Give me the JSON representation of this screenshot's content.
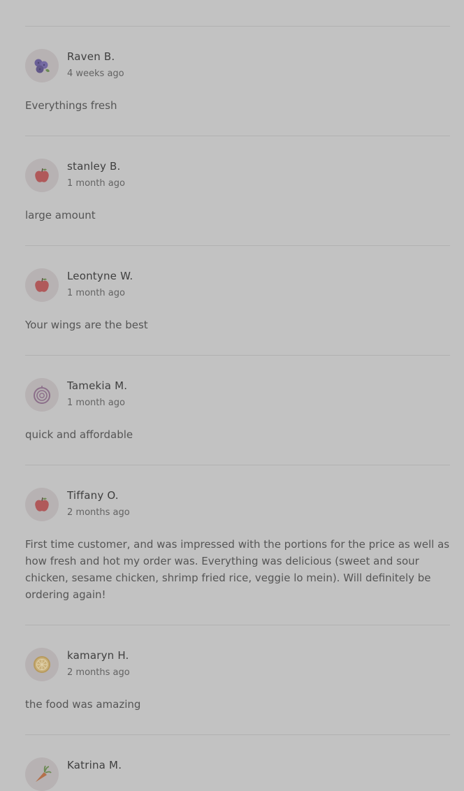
{
  "reviews": [
    {
      "name": "Raven B.",
      "time": "4 weeks ago",
      "text": "Everythings fresh",
      "avatar_icon": "blueberry-icon"
    },
    {
      "name": "stanley B.",
      "time": "1 month ago",
      "text": "large amount",
      "avatar_icon": "apple-icon"
    },
    {
      "name": "Leontyne W.",
      "time": "1 month ago",
      "text": "Your wings are the best",
      "avatar_icon": "apple-icon"
    },
    {
      "name": "Tamekia M.",
      "time": "1 month ago",
      "text": "quick and affordable",
      "avatar_icon": "onion-icon"
    },
    {
      "name": "Tiffany O.",
      "time": "2 months ago",
      "text": "First time customer, and was impressed with the portions for the price as well as how fresh and hot my order was. Everything was delicious (sweet and sour chicken, sesame chicken, shrimp fried rice, veggie lo mein). Will definitely be ordering again!",
      "avatar_icon": "apple-icon"
    },
    {
      "name": "kamaryn H.",
      "time": "2 months ago",
      "text": "the food was amazing",
      "avatar_icon": "lemon-icon"
    },
    {
      "name": "Katrina M.",
      "time": "",
      "text": "",
      "avatar_icon": "carrot-icon"
    }
  ],
  "colors": {
    "background": "#c2c2c2",
    "divider": "#b1b1b1",
    "avatar_bg": "#b7b2b3",
    "apple": "#b0595a",
    "blueberry": "#6a5f97",
    "onion": "#8c6f8a",
    "lemon": "#b89a5c",
    "carrot": "#b4704a",
    "leaf": "#6b8a53"
  }
}
